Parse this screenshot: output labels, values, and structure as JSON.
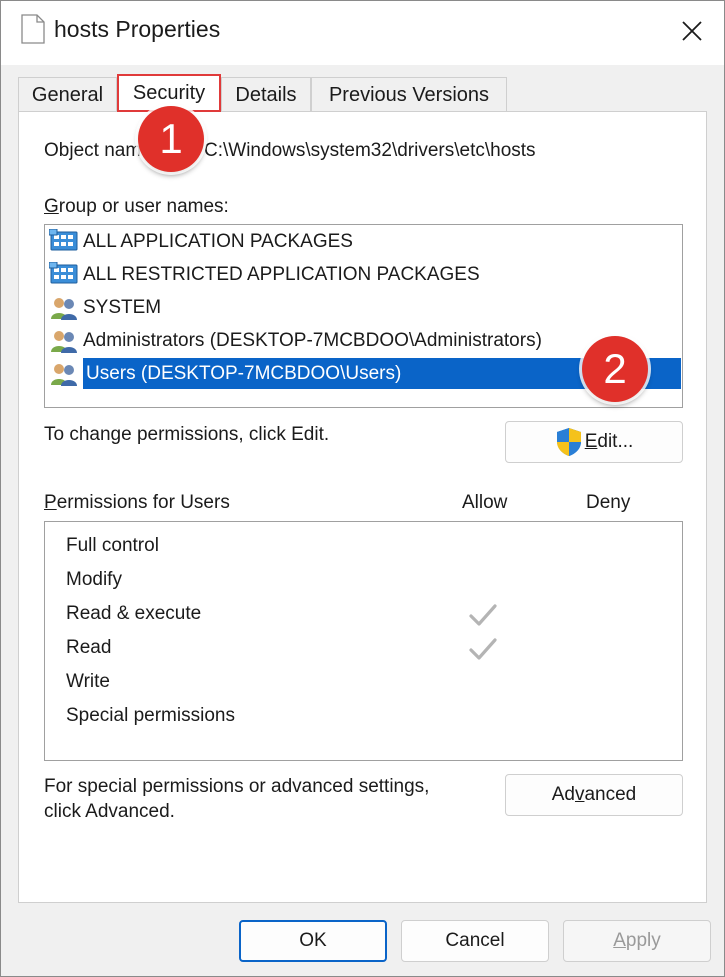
{
  "window": {
    "title": "hosts Properties"
  },
  "tabs": [
    {
      "label": "General"
    },
    {
      "label": "Security"
    },
    {
      "label": "Details"
    },
    {
      "label": "Previous Versions"
    }
  ],
  "object_name": {
    "label": "Object name:",
    "value": "C:\\Windows\\system32\\drivers\\etc\\hosts"
  },
  "groups": {
    "label_access_key": "G",
    "label_rest": "roup or user names:",
    "items": [
      {
        "label": "ALL APPLICATION PACKAGES",
        "icon": "app-packages-icon",
        "selected": false
      },
      {
        "label": "ALL RESTRICTED APPLICATION PACKAGES",
        "icon": "app-packages-icon",
        "selected": false
      },
      {
        "label": "SYSTEM",
        "icon": "users-group-icon",
        "selected": false
      },
      {
        "label": "Administrators (DESKTOP-7MCBDOO\\Administrators)",
        "icon": "users-group-icon",
        "selected": false
      },
      {
        "label": "Users (DESKTOP-7MCBDOO\\Users)",
        "icon": "users-group-icon",
        "selected": true
      }
    ]
  },
  "change_hint": "To change permissions, click Edit.",
  "edit_button": {
    "access_key": "E",
    "rest": "dit...",
    "icon": "uac-shield-icon"
  },
  "permissions": {
    "label_access_key": "P",
    "label_rest": "ermissions for Users",
    "allow_header": "Allow",
    "deny_header": "Deny",
    "rows": [
      {
        "name": "Full control",
        "allow": false,
        "deny": false
      },
      {
        "name": "Modify",
        "allow": false,
        "deny": false
      },
      {
        "name": "Read & execute",
        "allow": true,
        "deny": false
      },
      {
        "name": "Read",
        "allow": true,
        "deny": false
      },
      {
        "name": "Write",
        "allow": false,
        "deny": false
      },
      {
        "name": "Special permissions",
        "allow": false,
        "deny": false
      }
    ]
  },
  "advanced": {
    "hint_line1": "For special permissions or advanced settings,",
    "hint_line2": "click Advanced.",
    "button_pre": "Ad",
    "button_access_key": "v",
    "button_post": "anced"
  },
  "footer": {
    "ok": "OK",
    "cancel": "Cancel",
    "apply_access_key": "A",
    "apply_rest": "pply"
  },
  "annotations": {
    "step1": "1",
    "step2": "2"
  },
  "colors": {
    "highlight": "#0a64c8",
    "annotation": "#e0302a",
    "checkmark": "#b4b4b4"
  }
}
